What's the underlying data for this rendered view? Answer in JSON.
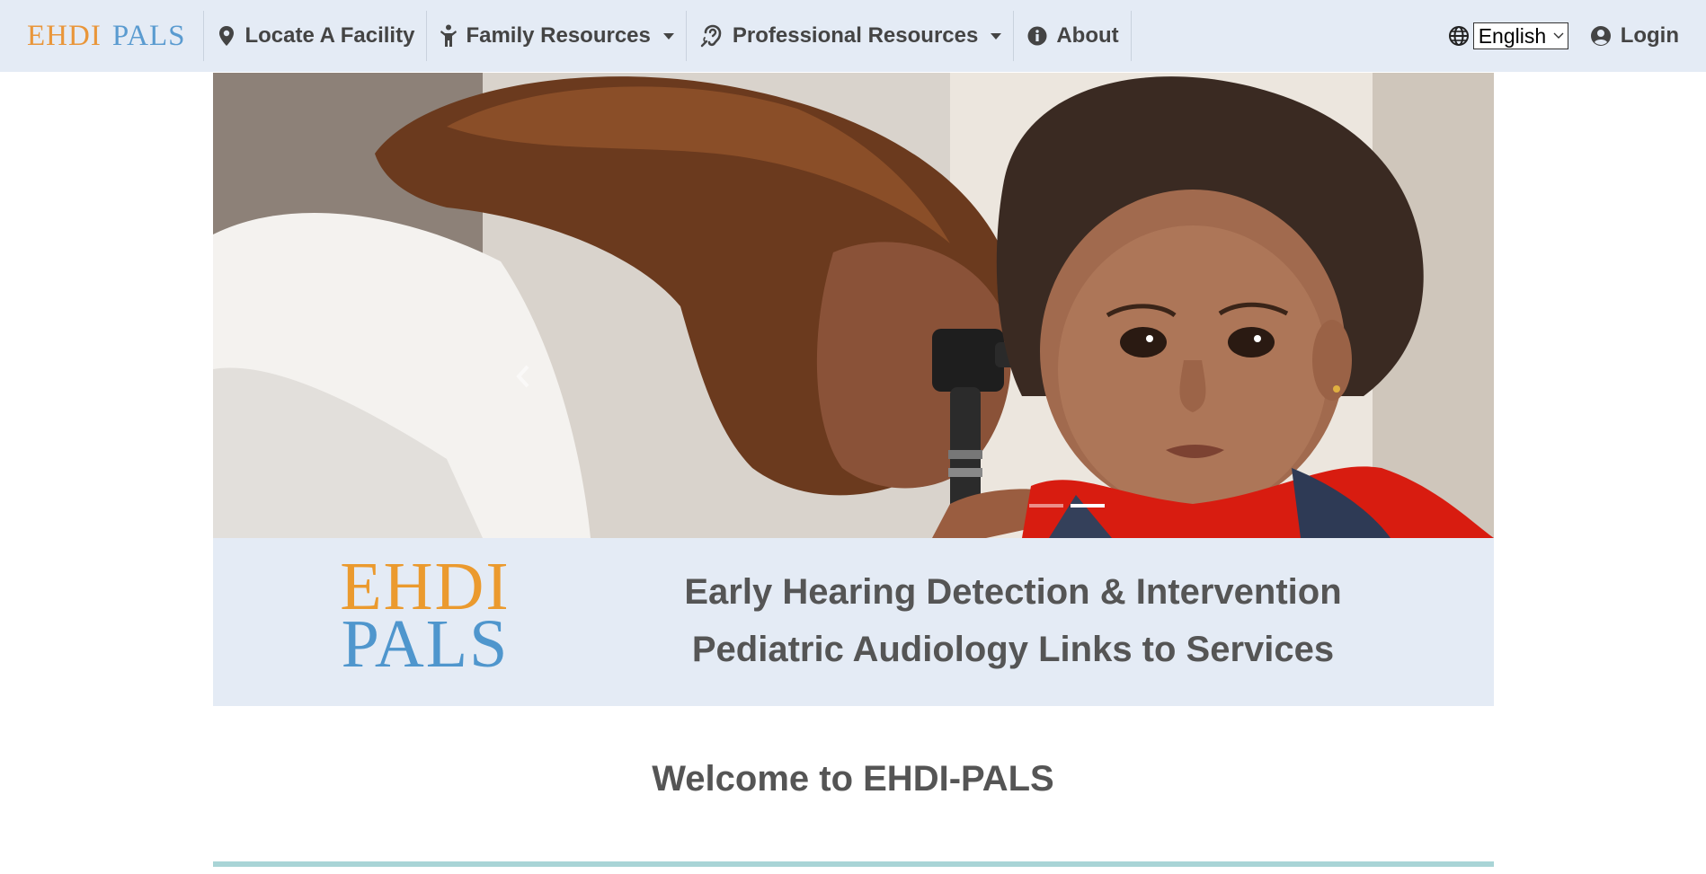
{
  "navbar": {
    "brand_part1": "EHDI",
    "brand_part2": "PALS",
    "items": [
      {
        "label": "Locate A Facility",
        "icon": "map-marker-icon"
      },
      {
        "label": "Family Resources",
        "icon": "child-icon",
        "dropdown": true
      },
      {
        "label": "Professional Resources",
        "icon": "ear-listening-icon",
        "dropdown": true
      },
      {
        "label": "About",
        "icon": "info-circle-icon"
      }
    ],
    "language": {
      "selected": "English",
      "icon": "globe-icon"
    },
    "login_label": "Login"
  },
  "carousel": {
    "slide_count": 2,
    "active_slide": 2,
    "image_description_icon": "doctor-examining-child-ear-photo"
  },
  "banner": {
    "logo_line1": "EHDI",
    "logo_line2": "PALS",
    "tagline_line1": "Early Hearing Detection & Intervention",
    "tagline_line2": "Pediatric Audiology Links to Services"
  },
  "welcome": {
    "heading": "Welcome to EHDI-PALS"
  },
  "colors": {
    "navbar_bg": "#e4ebf5",
    "brand_orange": "#e9963a",
    "brand_blue": "#5a9bd0",
    "divider": "#a9d4d6"
  }
}
